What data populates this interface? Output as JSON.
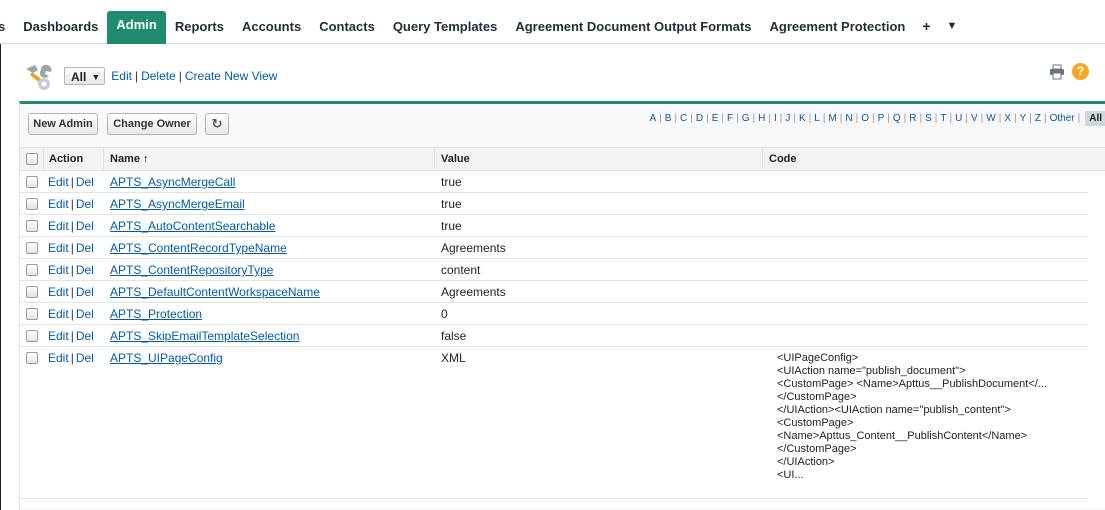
{
  "tabs": [
    {
      "label": "s"
    },
    {
      "label": "Dashboards"
    },
    {
      "label": "Admin",
      "active": true
    },
    {
      "label": "Reports"
    },
    {
      "label": "Accounts"
    },
    {
      "label": "Contacts"
    },
    {
      "label": "Query Templates"
    },
    {
      "label": "Agreement Document Output Formats"
    },
    {
      "label": "Agreement Protection"
    }
  ],
  "tab_icons": {
    "plus": "+",
    "more": "▼"
  },
  "view": {
    "selected": "All",
    "edit": "Edit",
    "delete": "Delete",
    "create": "Create New View",
    "separator": "|"
  },
  "toolbar": {
    "new_button": "New Admin",
    "owner_button": "Change Owner"
  },
  "alphabet": [
    "A",
    "B",
    "C",
    "D",
    "E",
    "F",
    "G",
    "H",
    "I",
    "J",
    "K",
    "L",
    "M",
    "N",
    "O",
    "P",
    "Q",
    "R",
    "S",
    "T",
    "U",
    "V",
    "W",
    "X",
    "Y",
    "Z",
    "Other"
  ],
  "alphabet_selected": "All",
  "columns": {
    "action": "Action",
    "name": "Name ↑",
    "value": "Value",
    "code": "Code"
  },
  "row_actions": {
    "edit": "Edit",
    "sep": "|",
    "del": "Del"
  },
  "rows": [
    {
      "name": "APTS_AsyncMergeCall",
      "value": "true"
    },
    {
      "name": "APTS_AsyncMergeEmail",
      "value": "true"
    },
    {
      "name": "APTS_AutoContentSearchable",
      "value": "true"
    },
    {
      "name": "APTS_ContentRecordTypeName",
      "value": "Agreements"
    },
    {
      "name": "APTS_ContentRepositoryType",
      "value": "content"
    },
    {
      "name": "APTS_DefaultContentWorkspaceName",
      "value": "Agreements"
    },
    {
      "name": "APTS_Protection",
      "value": "0"
    },
    {
      "name": "APTS_SkipEmailTemplateSelection",
      "value": "false"
    },
    {
      "name": "APTS_UIPageConfig",
      "value": "XML",
      "code": [
        "<UIPageConfig>",
        "<UIAction name=\"publish_document\">",
        "<CustomPage> <Name>Apttus__PublishDocument</...",
        "</CustomPage>",
        "</UIAction><UIAction name=\"publish_content\">",
        "<CustomPage>",
        "<Name>Apttus_Content__PublishContent</Name>",
        "</CustomPage>",
        "</UIAction>",
        "<UI..."
      ]
    }
  ],
  "colors": {
    "accent": "#1f8c6f",
    "link": "#015ba7",
    "help": "#f5a623"
  }
}
